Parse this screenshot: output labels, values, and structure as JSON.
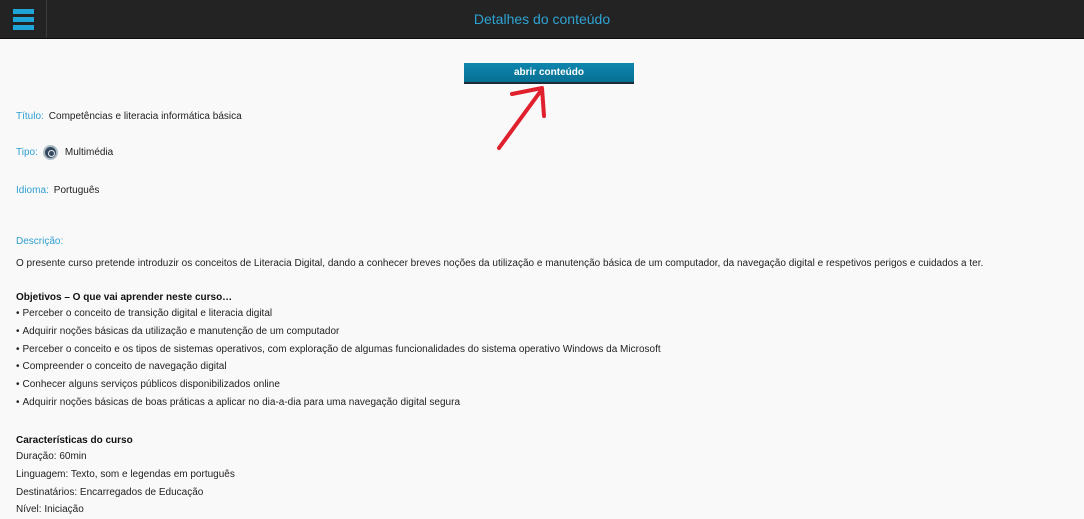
{
  "header": {
    "title": "Detalhes do conteúdo",
    "menu_icon": "hamburger-menu-icon",
    "accent_color": "#1fa4d8"
  },
  "open_button": {
    "label": "abrir conteúdo"
  },
  "details": {
    "title_label": "Título:",
    "title_value": "Competências e literacia informática básica",
    "type_label": "Tipo:",
    "type_value": "Multimédia",
    "type_icon": "multimedia-icon",
    "language_label": "Idioma:",
    "language_value": "Português",
    "description_label": "Descrição:",
    "description_text": "O presente curso pretende introduzir os conceitos de Literacia Digital, dando a conhecer breves noções da utilização e manutenção básica de um computador, da navegação digital e respetivos perigos e cuidados a ter."
  },
  "objectives": {
    "heading": "Objetivos – O que vai aprender neste curso…",
    "bullet": "•",
    "items": [
      "Perceber o conceito de transição digital e literacia digital",
      "Adquirir noções básicas da utilização e manutenção de um computador",
      "Perceber o conceito e os tipos de sistemas operativos, com exploração de algumas funcionalidades do sistema operativo Windows da Microsoft",
      "Compreender o conceito de navegação digital",
      "Conhecer alguns serviços públicos disponibilizados online",
      "Adquirir noções básicas de boas práticas a aplicar no dia-a-dia para uma navegação digital segura"
    ]
  },
  "characteristics": {
    "heading": "Características do curso",
    "items": [
      "Duração: 60min",
      "Linguagem: Texto, som e legendas em português",
      "Destinatários: Encarregados de Educação",
      "Nível: Iniciação"
    ]
  },
  "annotation": {
    "arrow_color": "#e0202c"
  }
}
